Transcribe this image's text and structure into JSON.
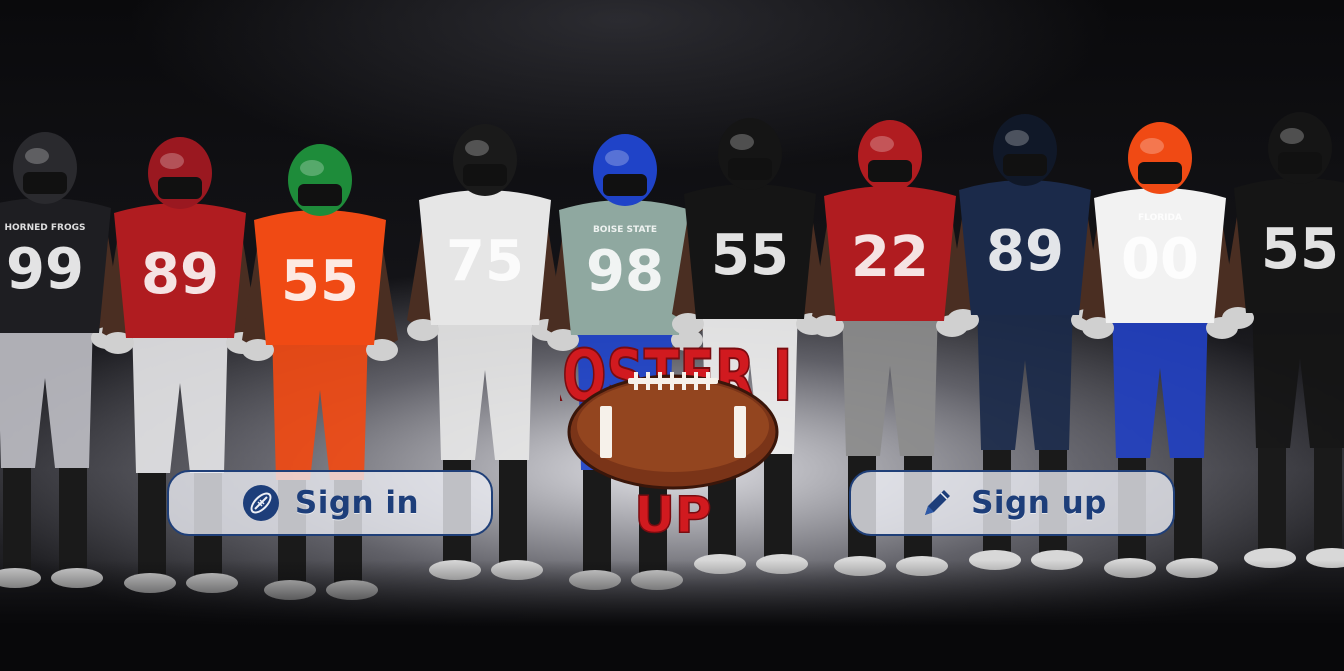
{
  "brand": {
    "logo_text_top": "ROSTER IT",
    "logo_text_bottom": "UP",
    "logo_color": "#d11a1f"
  },
  "auth": {
    "signin": {
      "label": "Sign in",
      "icon": "football-icon"
    },
    "signup": {
      "label": "Sign up",
      "icon": "pencil-icon"
    }
  },
  "players": [
    {
      "number": "99",
      "jersey": "#1e1e22",
      "helmet": "#2a2a2e",
      "pants": "#bcbcc2",
      "team_text": "HORNED FROGS"
    },
    {
      "number": "89",
      "jersey": "#b01c20",
      "helmet": "#9a1820",
      "pants": "#e4e4e6",
      "team_text": ""
    },
    {
      "number": "55",
      "jersey": "#f04a14",
      "helmet": "#1e8c3a",
      "pants": "#f04a14",
      "team_text": ""
    },
    {
      "number": "75",
      "jersey": "#e6e6e6",
      "helmet": "#1a1a1a",
      "pants": "#e6e6e6",
      "team_text": ""
    },
    {
      "number": "98",
      "jersey": "#8fa8a0",
      "helmet": "#1f43c8",
      "pants": "#1f43c8",
      "team_text": "BOISE STATE"
    },
    {
      "number": "55",
      "jersey": "#151515",
      "helmet": "#151515",
      "pants": "#eeeeee",
      "team_text": ""
    },
    {
      "number": "22",
      "jersey": "#b01c20",
      "helmet": "#b01c20",
      "pants": "#8c8c8c",
      "team_text": ""
    },
    {
      "number": "89",
      "jersey": "#1b2a4a",
      "helmet": "#101828",
      "pants": "#1b2a4a",
      "team_text": ""
    },
    {
      "number": "00",
      "jersey": "#f2f2f2",
      "helmet": "#f04a14",
      "pants": "#2240c0",
      "team_text": "FLORIDA"
    },
    {
      "number": "55",
      "jersey": "#151515",
      "helmet": "#151515",
      "pants": "#151515",
      "team_text": ""
    }
  ]
}
